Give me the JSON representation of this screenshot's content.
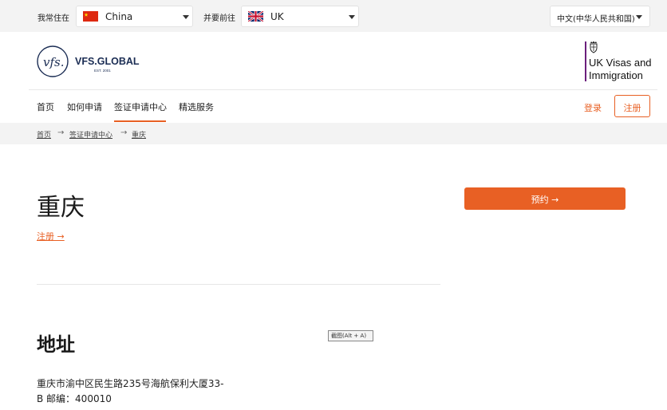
{
  "topbar": {
    "live_label": "我常住在",
    "live_country": "China",
    "going_label": "并要前往",
    "going_country": "UK",
    "language": "中文(中华人民共和国)"
  },
  "header": {
    "logo_text": "VFS.GLOBAL",
    "logo_sub": "EST. 2001",
    "logo_mark": "vfs.",
    "partner_line1": "UK Visas and",
    "partner_line2": "Immigration"
  },
  "nav": {
    "items": [
      "首页",
      "如何申请",
      "签证申请中心",
      "精选服务"
    ],
    "active_index": 2,
    "login": "登录",
    "register": "注册"
  },
  "breadcrumb": {
    "items": [
      "首页",
      "签证申请中心",
      "重庆"
    ],
    "separator": "→"
  },
  "main": {
    "title": "重庆",
    "register_link": "注册 →",
    "book_button": "预约 →",
    "address_title": "地址",
    "address_line1": "重庆市渝中区民生路235号海航保利大厦33-",
    "address_line2": "B 邮编：400010"
  },
  "tooltip": {
    "text": "截图(Alt + A)"
  },
  "colors": {
    "accent": "#e86024",
    "topbar_bg": "#f3f3f3",
    "brand_navy": "#1b2d54",
    "partner_purple": "#6b1f7c"
  }
}
